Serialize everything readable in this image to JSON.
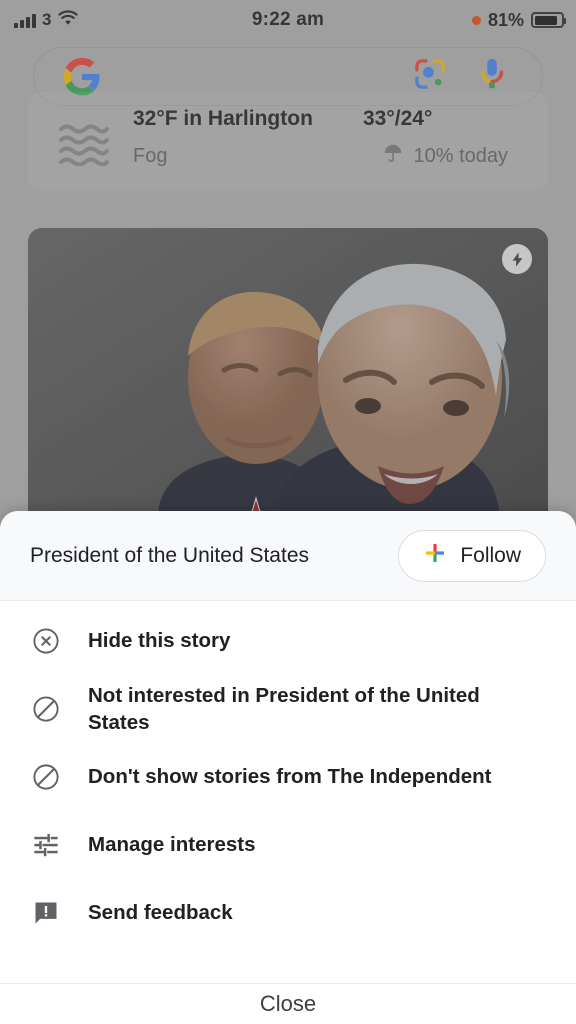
{
  "status_bar": {
    "carrier": "3",
    "time": "9:22 am",
    "battery_percent": "81%",
    "signal_icon": "signal-bars-icon",
    "wifi_icon": "wifi-icon",
    "recording_icon": "recording-dot-icon",
    "battery_icon": "battery-icon"
  },
  "search": {
    "placeholder": "",
    "value": "",
    "google_logo": "google-g-icon",
    "lens_icon": "google-lens-icon",
    "mic_icon": "microphone-icon"
  },
  "weather_card": {
    "icon": "fog-icon",
    "temperature": "32°F in Harlington",
    "condition": "Fog",
    "high_low": "33°/24°",
    "precip_icon": "umbrella-icon",
    "precipitation": "10% today"
  },
  "news_card": {
    "badge_icon": "amp-lightning-icon",
    "image_alt": "Two politicians at a press conference"
  },
  "sheet": {
    "title": "President of the United States",
    "follow": {
      "label": "Follow",
      "icon": "google-plus-icon"
    },
    "menu": [
      {
        "label": "Hide this story",
        "icon": "cancel-circle-icon"
      },
      {
        "label": "Not interested in President of the United States",
        "icon": "block-icon"
      },
      {
        "label": "Don't show stories from The Independent",
        "icon": "block-icon"
      },
      {
        "label": "Manage interests",
        "icon": "tune-sliders-icon"
      },
      {
        "label": "Send feedback",
        "icon": "feedback-bubble-icon"
      }
    ],
    "close_label": "Close"
  },
  "colors": {
    "google_blue": "#4285F4",
    "google_red": "#EA4335",
    "google_yellow": "#FBBC05",
    "google_green": "#34A853",
    "sheet_header_bg": "#F8F9FA",
    "text_primary": "#202124",
    "text_secondary": "#5F6368",
    "battery_dot": "#E8480F"
  }
}
